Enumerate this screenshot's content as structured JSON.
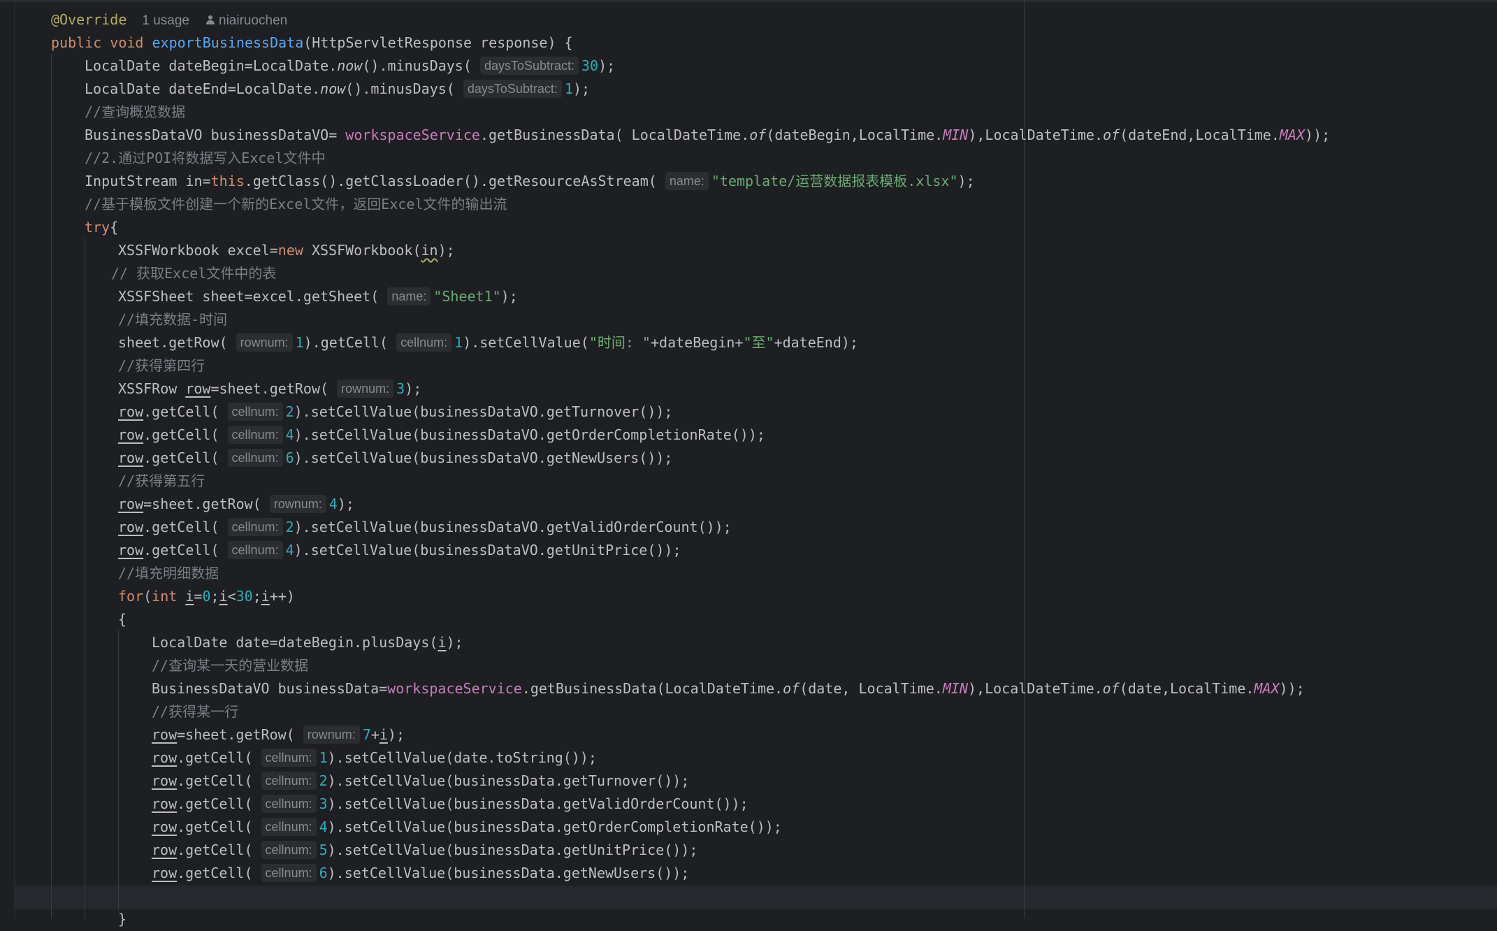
{
  "meta": {
    "annotation": "@Override",
    "usages": "1 usage",
    "author": "niairuochen"
  },
  "code": [
    {
      "indent": 0,
      "tokens": [
        {
          "t": "public void ",
          "c": "kw"
        },
        {
          "t": "exportBusinessData",
          "c": "fn"
        },
        {
          "t": "(HttpServletResponse response) {"
        }
      ]
    },
    {
      "indent": 1,
      "tokens": [
        {
          "t": "LocalDate dateBegin=LocalDate."
        },
        {
          "t": "now",
          "c": "it"
        },
        {
          "t": "().minusDays( "
        },
        {
          "t": "daysToSubtract:",
          "c": "hint"
        },
        {
          "t": "30",
          "c": "num"
        },
        {
          "t": ");"
        }
      ]
    },
    {
      "indent": 1,
      "tokens": [
        {
          "t": "LocalDate dateEnd=LocalDate."
        },
        {
          "t": "now",
          "c": "it"
        },
        {
          "t": "().minusDays( "
        },
        {
          "t": "daysToSubtract:",
          "c": "hint"
        },
        {
          "t": "1",
          "c": "num"
        },
        {
          "t": ");"
        }
      ]
    },
    {
      "indent": 1,
      "tokens": [
        {
          "t": "//查询概览数据",
          "c": "cmt"
        }
      ]
    },
    {
      "indent": 1,
      "tokens": [
        {
          "t": "BusinessDataVO businessDataVO= "
        },
        {
          "t": "workspaceService",
          "c": "fld"
        },
        {
          "t": ".getBusinessData( LocalDateTime."
        },
        {
          "t": "of",
          "c": "it"
        },
        {
          "t": "(dateBegin,LocalTime."
        },
        {
          "t": "MIN",
          "c": "cst"
        },
        {
          "t": "),LocalDateTime."
        },
        {
          "t": "of",
          "c": "it"
        },
        {
          "t": "(dateEnd,LocalTime."
        },
        {
          "t": "MAX",
          "c": "cst"
        },
        {
          "t": "));"
        }
      ]
    },
    {
      "indent": 1,
      "tokens": [
        {
          "t": "//2.通过POI将数据写入Excel文件中",
          "c": "cmt"
        }
      ]
    },
    {
      "indent": 1,
      "tokens": [
        {
          "t": "InputStream in="
        },
        {
          "t": "this",
          "c": "kw"
        },
        {
          "t": ".getClass().getClassLoader().getResourceAsStream( "
        },
        {
          "t": "name:",
          "c": "hint"
        },
        {
          "t": "\"template/运营数据报表模板.xlsx\"",
          "c": "str"
        },
        {
          "t": ");"
        }
      ]
    },
    {
      "indent": 1,
      "tokens": [
        {
          "t": "//基于模板文件创建一个新的Excel文件，返回Excel文件的输出流",
          "c": "cmt"
        }
      ]
    },
    {
      "indent": 1,
      "tokens": [
        {
          "t": "try",
          "c": "kw"
        },
        {
          "t": "{"
        }
      ]
    },
    {
      "indent": 2,
      "tokens": [
        {
          "t": "XSSFWorkbook excel="
        },
        {
          "t": "new",
          "c": "kw"
        },
        {
          "t": " XSSFWorkbook("
        },
        {
          "t": "in",
          "c": "wavy"
        },
        {
          "t": ");"
        }
      ]
    },
    {
      "indent": 2,
      "pad": -1,
      "tokens": [
        {
          "t": "// 获取Excel文件中的表",
          "c": "cmt"
        }
      ]
    },
    {
      "indent": 2,
      "tokens": [
        {
          "t": "XSSFSheet sheet=excel.getSheet( "
        },
        {
          "t": "name:",
          "c": "hint"
        },
        {
          "t": "\"Sheet1\"",
          "c": "str"
        },
        {
          "t": ");"
        }
      ]
    },
    {
      "indent": 2,
      "tokens": [
        {
          "t": "//填充数据-时间",
          "c": "cmt"
        }
      ]
    },
    {
      "indent": 2,
      "tokens": [
        {
          "t": "sheet.getRow( "
        },
        {
          "t": "rownum:",
          "c": "hint"
        },
        {
          "t": "1",
          "c": "num"
        },
        {
          "t": ").getCell( "
        },
        {
          "t": "cellnum:",
          "c": "hint"
        },
        {
          "t": "1",
          "c": "num"
        },
        {
          "t": ").setCellValue("
        },
        {
          "t": "\"时间: \"",
          "c": "str"
        },
        {
          "t": "+dateBegin+"
        },
        {
          "t": "\"至\"",
          "c": "str"
        },
        {
          "t": "+dateEnd);"
        }
      ]
    },
    {
      "indent": 2,
      "tokens": [
        {
          "t": "//获得第四行",
          "c": "cmt"
        }
      ]
    },
    {
      "indent": 2,
      "tokens": [
        {
          "t": "XSSFRow "
        },
        {
          "t": "row",
          "c": "ul"
        },
        {
          "t": "=sheet.getRow( "
        },
        {
          "t": "rownum:",
          "c": "hint"
        },
        {
          "t": "3",
          "c": "num"
        },
        {
          "t": ");"
        }
      ]
    },
    {
      "indent": 2,
      "tokens": [
        {
          "t": "row",
          "c": "ul"
        },
        {
          "t": ".getCell( "
        },
        {
          "t": "cellnum:",
          "c": "hint"
        },
        {
          "t": "2",
          "c": "num"
        },
        {
          "t": ").setCellValue(businessDataVO.getTurnover());"
        }
      ]
    },
    {
      "indent": 2,
      "tokens": [
        {
          "t": "row",
          "c": "ul"
        },
        {
          "t": ".getCell( "
        },
        {
          "t": "cellnum:",
          "c": "hint"
        },
        {
          "t": "4",
          "c": "num"
        },
        {
          "t": ").setCellValue(businessDataVO.getOrderCompletionRate());"
        }
      ]
    },
    {
      "indent": 2,
      "tokens": [
        {
          "t": "row",
          "c": "ul"
        },
        {
          "t": ".getCell( "
        },
        {
          "t": "cellnum:",
          "c": "hint"
        },
        {
          "t": "6",
          "c": "num"
        },
        {
          "t": ").setCellValue(businessDataVO.getNewUsers());"
        }
      ]
    },
    {
      "indent": 2,
      "tokens": [
        {
          "t": "//获得第五行",
          "c": "cmt"
        }
      ]
    },
    {
      "indent": 2,
      "tokens": [
        {
          "t": "row",
          "c": "ul"
        },
        {
          "t": "=sheet.getRow( "
        },
        {
          "t": "rownum:",
          "c": "hint"
        },
        {
          "t": "4",
          "c": "num"
        },
        {
          "t": ");"
        }
      ]
    },
    {
      "indent": 2,
      "tokens": [
        {
          "t": "row",
          "c": "ul"
        },
        {
          "t": ".getCell( "
        },
        {
          "t": "cellnum:",
          "c": "hint"
        },
        {
          "t": "2",
          "c": "num"
        },
        {
          "t": ").setCellValue(businessDataVO.getValidOrderCount());"
        }
      ]
    },
    {
      "indent": 2,
      "tokens": [
        {
          "t": "row",
          "c": "ul"
        },
        {
          "t": ".getCell( "
        },
        {
          "t": "cellnum:",
          "c": "hint"
        },
        {
          "t": "4",
          "c": "num"
        },
        {
          "t": ").setCellValue(businessDataVO.getUnitPrice());"
        }
      ]
    },
    {
      "indent": 2,
      "tokens": [
        {
          "t": "//填充明细数据",
          "c": "cmt"
        }
      ]
    },
    {
      "indent": 2,
      "tokens": [
        {
          "t": "for",
          "c": "kw"
        },
        {
          "t": "("
        },
        {
          "t": "int ",
          "c": "kw"
        },
        {
          "t": "i",
          "c": "ul"
        },
        {
          "t": "="
        },
        {
          "t": "0",
          "c": "num"
        },
        {
          "t": ";"
        },
        {
          "t": "i",
          "c": "ul"
        },
        {
          "t": "<"
        },
        {
          "t": "30",
          "c": "num"
        },
        {
          "t": ";"
        },
        {
          "t": "i",
          "c": "ul"
        },
        {
          "t": "++)"
        }
      ]
    },
    {
      "indent": 2,
      "tokens": [
        {
          "t": "{"
        }
      ]
    },
    {
      "indent": 3,
      "tokens": [
        {
          "t": "LocalDate date=dateBegin.plusDays("
        },
        {
          "t": "i",
          "c": "ul"
        },
        {
          "t": ");"
        }
      ]
    },
    {
      "indent": 3,
      "tokens": [
        {
          "t": "//查询某一天的营业数据",
          "c": "cmt"
        }
      ]
    },
    {
      "indent": 3,
      "tokens": [
        {
          "t": "BusinessDataVO businessData="
        },
        {
          "t": "workspaceService",
          "c": "fld"
        },
        {
          "t": ".getBusinessData(LocalDateTime."
        },
        {
          "t": "of",
          "c": "it"
        },
        {
          "t": "(date, LocalTime."
        },
        {
          "t": "MIN",
          "c": "cst"
        },
        {
          "t": "),LocalDateTime."
        },
        {
          "t": "of",
          "c": "it"
        },
        {
          "t": "(date,LocalTime."
        },
        {
          "t": "MAX",
          "c": "cst"
        },
        {
          "t": "));"
        }
      ]
    },
    {
      "indent": 3,
      "tokens": [
        {
          "t": "//获得某一行",
          "c": "cmt"
        }
      ]
    },
    {
      "indent": 3,
      "tokens": [
        {
          "t": "row",
          "c": "ul"
        },
        {
          "t": "=sheet.getRow( "
        },
        {
          "t": "rownum:",
          "c": "hint"
        },
        {
          "t": "7",
          "c": "num"
        },
        {
          "t": "+"
        },
        {
          "t": "i",
          "c": "ul"
        },
        {
          "t": ");"
        }
      ]
    },
    {
      "indent": 3,
      "tokens": [
        {
          "t": "row",
          "c": "ul"
        },
        {
          "t": ".getCell( "
        },
        {
          "t": "cellnum:",
          "c": "hint"
        },
        {
          "t": "1",
          "c": "num"
        },
        {
          "t": ").setCellValue(date.toString());"
        }
      ]
    },
    {
      "indent": 3,
      "tokens": [
        {
          "t": "row",
          "c": "ul"
        },
        {
          "t": ".getCell( "
        },
        {
          "t": "cellnum:",
          "c": "hint"
        },
        {
          "t": "2",
          "c": "num"
        },
        {
          "t": ").setCellValue(businessData.getTurnover());"
        }
      ]
    },
    {
      "indent": 3,
      "tokens": [
        {
          "t": "row",
          "c": "ul"
        },
        {
          "t": ".getCell( "
        },
        {
          "t": "cellnum:",
          "c": "hint"
        },
        {
          "t": "3",
          "c": "num"
        },
        {
          "t": ").setCellValue(businessData.getValidOrderCount());"
        }
      ]
    },
    {
      "indent": 3,
      "tokens": [
        {
          "t": "row",
          "c": "ul"
        },
        {
          "t": ".getCell( "
        },
        {
          "t": "cellnum:",
          "c": "hint"
        },
        {
          "t": "4",
          "c": "num"
        },
        {
          "t": ").setCellValue(businessData.getOrderCompletionRate());"
        }
      ]
    },
    {
      "indent": 3,
      "tokens": [
        {
          "t": "row",
          "c": "ul"
        },
        {
          "t": ".getCell( "
        },
        {
          "t": "cellnum:",
          "c": "hint"
        },
        {
          "t": "5",
          "c": "num"
        },
        {
          "t": ").setCellValue(businessData.getUnitPrice());"
        }
      ]
    },
    {
      "indent": 3,
      "tokens": [
        {
          "t": "row",
          "c": "ul"
        },
        {
          "t": ".getCell( "
        },
        {
          "t": "cellnum:",
          "c": "hint"
        },
        {
          "t": "6",
          "c": "num"
        },
        {
          "t": ").setCellValue(businessData.getNewUsers());"
        }
      ]
    },
    {
      "indent": 3,
      "tokens": []
    },
    {
      "indent": 2,
      "tokens": [
        {
          "t": "}"
        }
      ]
    }
  ]
}
